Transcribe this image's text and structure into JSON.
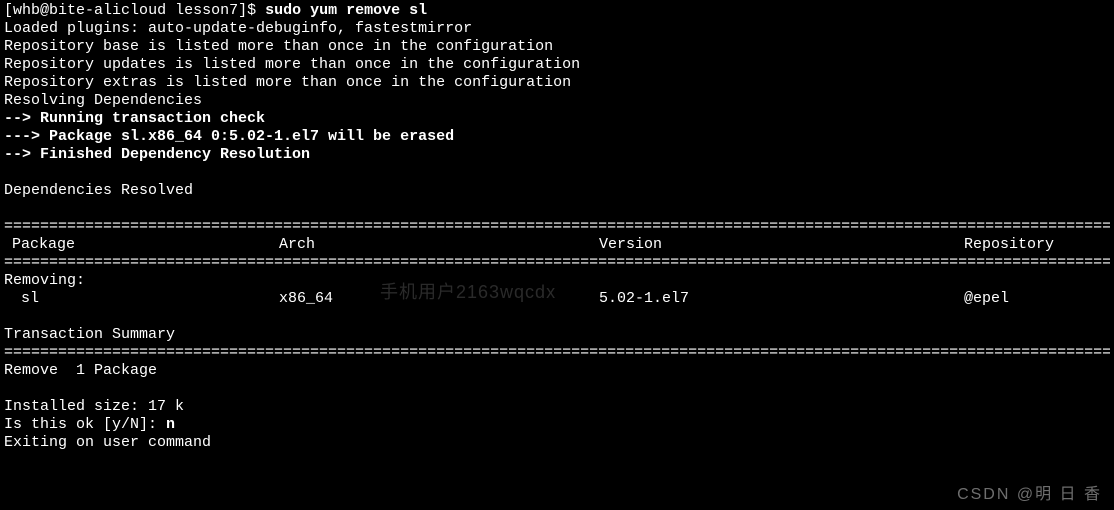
{
  "prompt": {
    "user": "whb",
    "host": "bite-alicloud",
    "cwd": "lesson7",
    "symbol": "$",
    "command": "sudo yum remove sl"
  },
  "output": {
    "loaded_plugins": "Loaded plugins: auto-update-debuginfo, fastestmirror",
    "repo_base": "Repository base is listed more than once in the configuration",
    "repo_updates": "Repository updates is listed more than once in the configuration",
    "repo_extras": "Repository extras is listed more than once in the configuration",
    "resolving": "Resolving Dependencies",
    "run_check": "--> Running transaction check",
    "pkg_erase": "---> Package sl.x86_64 0:5.02-1.el7 will be erased",
    "finished": "--> Finished Dependency Resolution",
    "deps_resolved": "Dependencies Resolved"
  },
  "table": {
    "headers": {
      "package": "Package",
      "arch": "Arch",
      "version": "Version",
      "repository": "Repository"
    },
    "removing_label": "Removing:",
    "row": {
      "package": " sl",
      "arch": "x86_64",
      "version": "5.02-1.el7",
      "repository": "@epel"
    }
  },
  "summary": {
    "title": "Transaction Summary",
    "remove": "Remove  1 Package",
    "installed_size": "Installed size: 17 k",
    "confirm_prompt": "Is this ok [y/N]: ",
    "confirm_answer": "n",
    "exiting": "Exiting on user command"
  },
  "separators": {
    "equals": "================================================================================================================================================"
  },
  "watermarks": {
    "mid": "手机用户2163wqcdx",
    "corner": "CSDN @明 日 香"
  }
}
